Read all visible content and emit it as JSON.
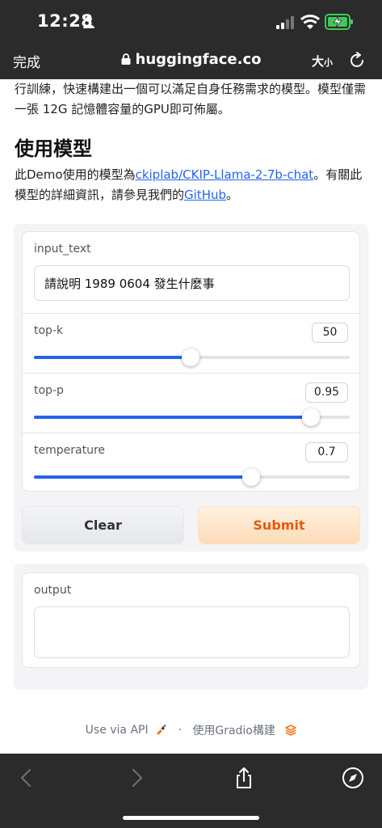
{
  "status": {
    "time": "12:28"
  },
  "browser": {
    "done_label": "完成",
    "url": "huggingface.co",
    "text_size_label_big": "大",
    "text_size_label_small": "小"
  },
  "page": {
    "intro_text": "行訓練，快速構建出一個可以滿足自身任務需求的模型。模型僅需一張 12G 記憶體容量的GPU即可佈屬。",
    "section_title": "使用模型",
    "desc_prefix": "此Demo使用的模型為",
    "model_link": "ckiplab/CKIP-Llama-2-7b-chat",
    "desc_middle": "。有關此模型的詳細資訊，請參見我們的",
    "github_link": "GitHub",
    "desc_suffix": "。"
  },
  "form": {
    "input_label": "input_text",
    "input_value": "請說明 1989 0604 發生什麼事",
    "sliders": [
      {
        "label": "top-k",
        "value_text": "50",
        "fraction": 0.496
      },
      {
        "label": "top-p",
        "value_text": "0.95",
        "fraction": 0.877
      },
      {
        "label": "temperature",
        "value_text": "0.7",
        "fraction": 0.687
      }
    ],
    "clear_label": "Clear",
    "submit_label": "Submit"
  },
  "output": {
    "label": "output",
    "value": ""
  },
  "footer": {
    "api_label": "Use via API",
    "separator": "·",
    "built_with": "使用Gradio構建"
  },
  "colors": {
    "accent": "#2563eb",
    "submit_text": "#ea580c",
    "chrome": "#2b2b2b"
  }
}
